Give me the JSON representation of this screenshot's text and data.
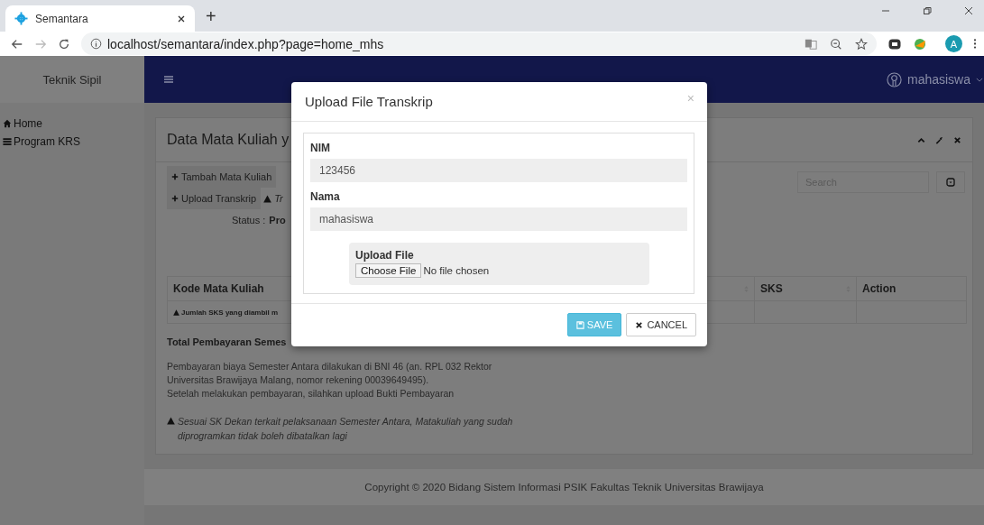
{
  "browser": {
    "tab_title": "Semantara",
    "new_tab": "+",
    "address_url": "localhost/semantara/index.php?page=home_mhs",
    "profile_initial": "A"
  },
  "sidebar": {
    "brand": "Teknik Sipil",
    "items": [
      {
        "label": "Home",
        "kind": "home"
      },
      {
        "label": "Program KRS",
        "kind": "list"
      }
    ]
  },
  "header": {
    "user": "mahasiswa"
  },
  "panel": {
    "title": "Data Mata Kuliah y",
    "buttons": [
      "Tambah Mata Kuliah",
      "Upload Transkrip"
    ],
    "upload_note": "Tr",
    "status_label": "Status :",
    "status_value": "Pro",
    "search": {
      "placeholder": "Search"
    },
    "table": {
      "columns": [
        "Kode Mata Kuliah",
        "",
        "SKS",
        "Action"
      ],
      "notice": "Jumlah SKS yang diambil m"
    },
    "total_label": "Total Pembayaran Semes",
    "payment_lines": [
      "Pembayaran biaya Semester Antara dilakukan di BNI 46 (an. RPL 032 Rektor Universitas Brawijaya Malang, nomor rekening 00039649495).",
      "Setelah melakukan pembayaran, silahkan upload Bukti Pembayaran"
    ],
    "warning": "Sesuai SK Dekan terkait pelaksanaan Semester Antara, Matakuliah yang sudah diprogramkan tidak boleh dibatalkan lagi"
  },
  "footer": {
    "copyright": "Copyright © 2020 Bidang Sistem Informasi PSIK Fakultas Teknik Universitas Brawijaya"
  },
  "modal": {
    "title": "Upload File Transkrip",
    "close": "×",
    "fields": [
      {
        "label": "NIM",
        "value": "123456"
      },
      {
        "label": "Nama",
        "value": "mahasiswa"
      }
    ],
    "upload_label": "Upload File",
    "file_button": "Choose File",
    "file_status": "No file chosen",
    "save": "SAVE",
    "cancel": "CANCEL"
  }
}
